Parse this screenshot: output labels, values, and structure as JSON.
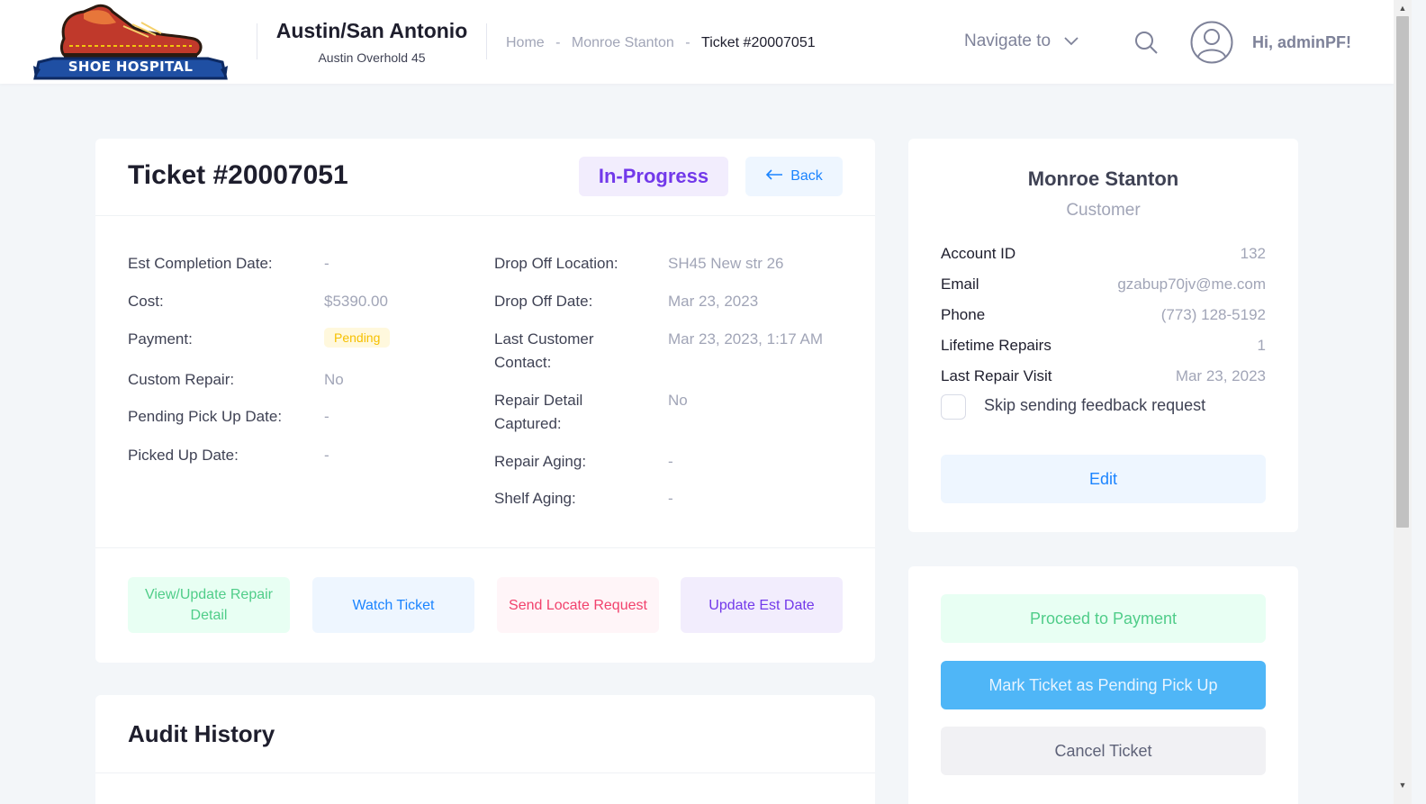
{
  "brand": {
    "logo_text": "SHOE HOSPITAL"
  },
  "store": {
    "name": "Austin/San Antonio",
    "sub": "Austin Overhold 45"
  },
  "breadcrumb": {
    "home": "Home",
    "sep": "-",
    "customer": "Monroe Stanton",
    "current": "Ticket #20007051"
  },
  "header": {
    "navigate_label": "Navigate to",
    "greeting": "Hi, adminPF!"
  },
  "ticket": {
    "title": "Ticket #20007051",
    "status": "In-Progress",
    "back_label": "Back",
    "left_fields": [
      {
        "label": "Est Completion Date:",
        "value": "-"
      },
      {
        "label": "Cost:",
        "value": "$5390.00"
      },
      {
        "label": "Payment:",
        "value": "Pending"
      },
      {
        "label": "Custom Repair:",
        "value": "No"
      },
      {
        "label": "Pending Pick Up Date:",
        "value": "-"
      },
      {
        "label": "Picked Up Date:",
        "value": "-"
      }
    ],
    "right_fields": [
      {
        "label": "Drop Off Location:",
        "value": "SH45 New str 26"
      },
      {
        "label": "Drop Off Date:",
        "value": "Mar 23, 2023"
      },
      {
        "label": "Last Customer Contact:",
        "value": "Mar 23, 2023, 1:17 AM"
      },
      {
        "label": "Repair Detail Captured:",
        "value": "No"
      },
      {
        "label": "Repair Aging:",
        "value": "-"
      },
      {
        "label": "Shelf Aging:",
        "value": "-"
      }
    ],
    "actions": {
      "view_update": "View/Update Repair Detail",
      "watch": "Watch Ticket",
      "send_locate": "Send Locate Request",
      "update_est": "Update Est Date"
    }
  },
  "audit": {
    "title": "Audit History"
  },
  "customer": {
    "name": "Monroe Stanton",
    "role": "Customer",
    "rows": [
      {
        "key": "Account ID",
        "value": "132"
      },
      {
        "key": "Email",
        "value": "gzabup70jv@me.com"
      },
      {
        "key": "Phone",
        "value": "(773) 128-5192"
      },
      {
        "key": "Lifetime Repairs",
        "value": "1"
      },
      {
        "key": "Last Repair Visit",
        "value": "Mar 23, 2023"
      }
    ],
    "skip_feedback_label": "Skip sending feedback request",
    "edit_label": "Edit"
  },
  "ticket_actions": {
    "proceed_payment": "Proceed to Payment",
    "mark_pending": "Mark Ticket as Pending Pick Up",
    "cancel": "Cancel Ticket"
  },
  "colors": {
    "accent": "#1b84ff",
    "purple": "#7239ea",
    "green": "#50cd89",
    "red": "#f1416c",
    "warning": "#f6c000"
  }
}
